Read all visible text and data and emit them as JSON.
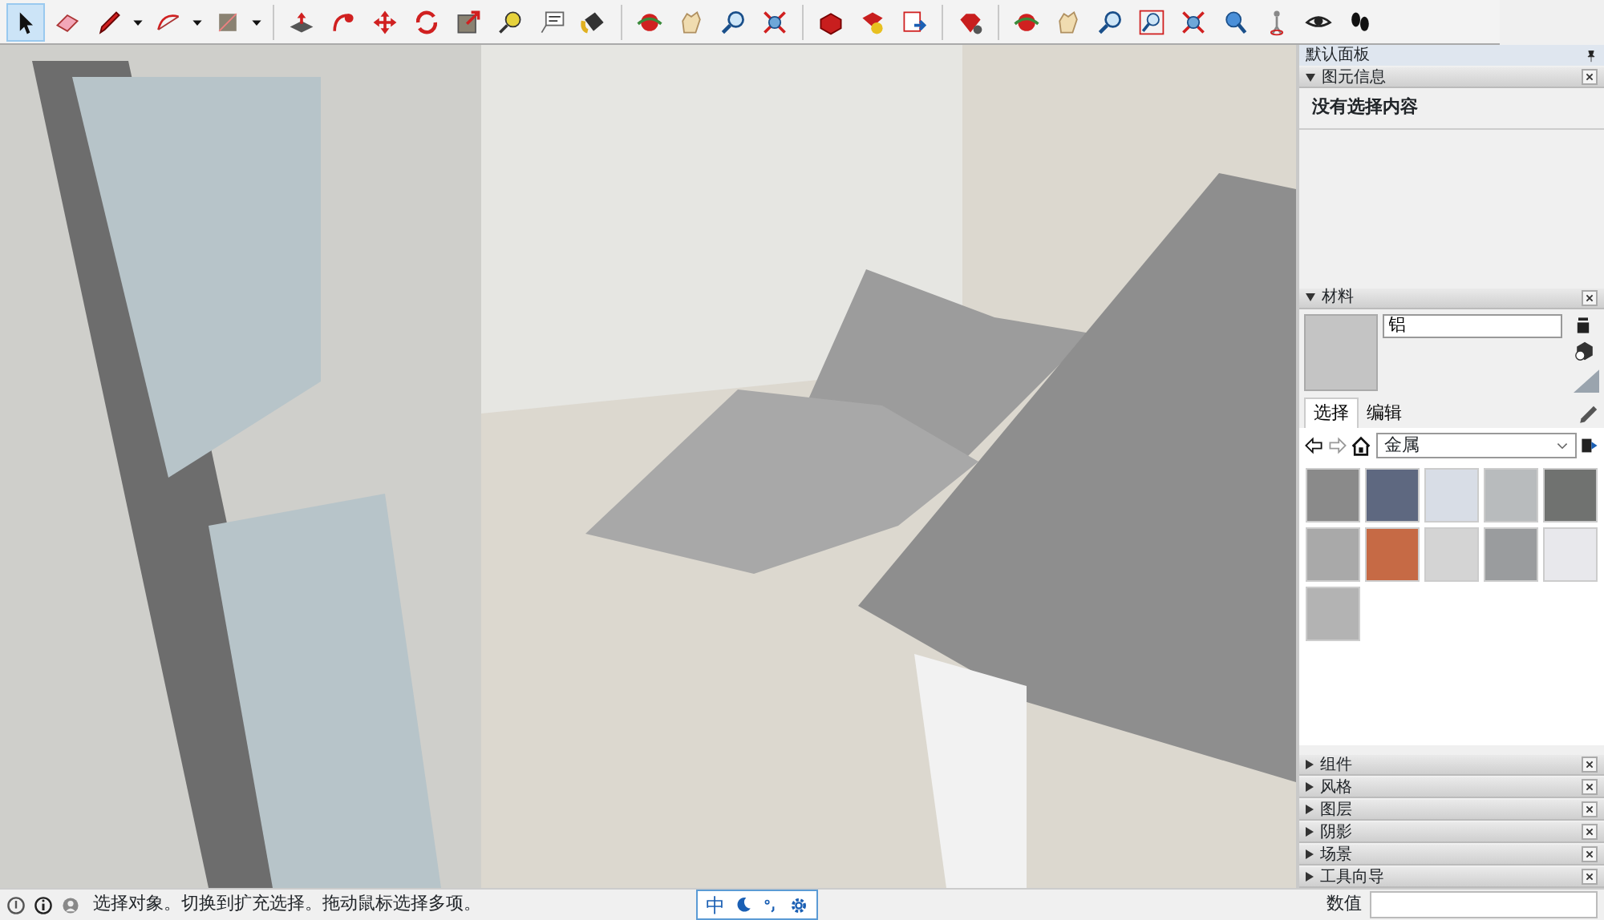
{
  "toolbar": {
    "tools": [
      {
        "selected": true,
        "dropdown": false
      },
      {
        "selected": false,
        "dropdown": false
      },
      {
        "selected": false,
        "dropdown": true
      },
      {
        "selected": false,
        "dropdown": true
      },
      {
        "selected": false,
        "dropdown": true
      },
      {
        "selected": false,
        "dropdown": false
      },
      {
        "selected": false,
        "dropdown": false
      },
      {
        "selected": false,
        "dropdown": false
      },
      {
        "selected": false,
        "dropdown": false
      },
      {
        "selected": false,
        "dropdown": false
      },
      {
        "selected": false,
        "dropdown": false
      },
      {
        "selected": false,
        "dropdown": false
      },
      {
        "selected": false,
        "dropdown": false
      },
      {
        "selected": false,
        "dropdown": false
      },
      {
        "selected": false,
        "dropdown": false
      },
      {
        "selected": false,
        "dropdown": false
      },
      {
        "selected": false,
        "dropdown": false
      },
      {
        "selected": false,
        "dropdown": false
      },
      {
        "selected": false,
        "dropdown": false
      },
      {
        "selected": false,
        "dropdown": false
      },
      {
        "selected": false,
        "dropdown": false
      },
      {
        "selected": false,
        "dropdown": false
      },
      {
        "selected": false,
        "dropdown": false
      },
      {
        "selected": false,
        "dropdown": false
      },
      {
        "selected": false,
        "dropdown": false
      },
      {
        "selected": false,
        "dropdown": false
      },
      {
        "selected": false,
        "dropdown": false
      },
      {
        "selected": false,
        "dropdown": false
      },
      {
        "selected": false,
        "dropdown": false
      },
      {
        "selected": false,
        "dropdown": false
      }
    ]
  },
  "tray": {
    "title": "默认面板",
    "entity_info": {
      "title": "图元信息",
      "expanded": true,
      "message": "没有选择内容"
    },
    "materials": {
      "title": "材料",
      "expanded": true,
      "name": "铝",
      "tabs": [
        {
          "label": "选择",
          "selected": true
        },
        {
          "label": "编辑",
          "selected": false
        }
      ],
      "library": "金属",
      "swatches": [
        {
          "color": "#8a8a8a"
        },
        {
          "color": "#5e6880"
        },
        {
          "color": "#d8dde6"
        },
        {
          "color": "#b8bbbd"
        },
        {
          "color": "#707270"
        },
        {
          "color": "#a9a9a9"
        },
        {
          "color": "#c66a45"
        },
        {
          "color": "#d4d4d4"
        },
        {
          "color": "#9a9c9e"
        },
        {
          "color": "#e8e8ec"
        },
        {
          "color": "#b3b3b3"
        }
      ]
    },
    "panels": [
      {
        "title": "组件",
        "expanded": false
      },
      {
        "title": "风格",
        "expanded": false
      },
      {
        "title": "图层",
        "expanded": false
      },
      {
        "title": "阴影",
        "expanded": false
      },
      {
        "title": "场景",
        "expanded": false
      },
      {
        "title": "工具向导",
        "expanded": false
      }
    ]
  },
  "status_bar": {
    "message": "选择对象。切换到扩充选择。拖动鼠标选择多项。",
    "ime": "中",
    "measurement_label": "数值"
  }
}
